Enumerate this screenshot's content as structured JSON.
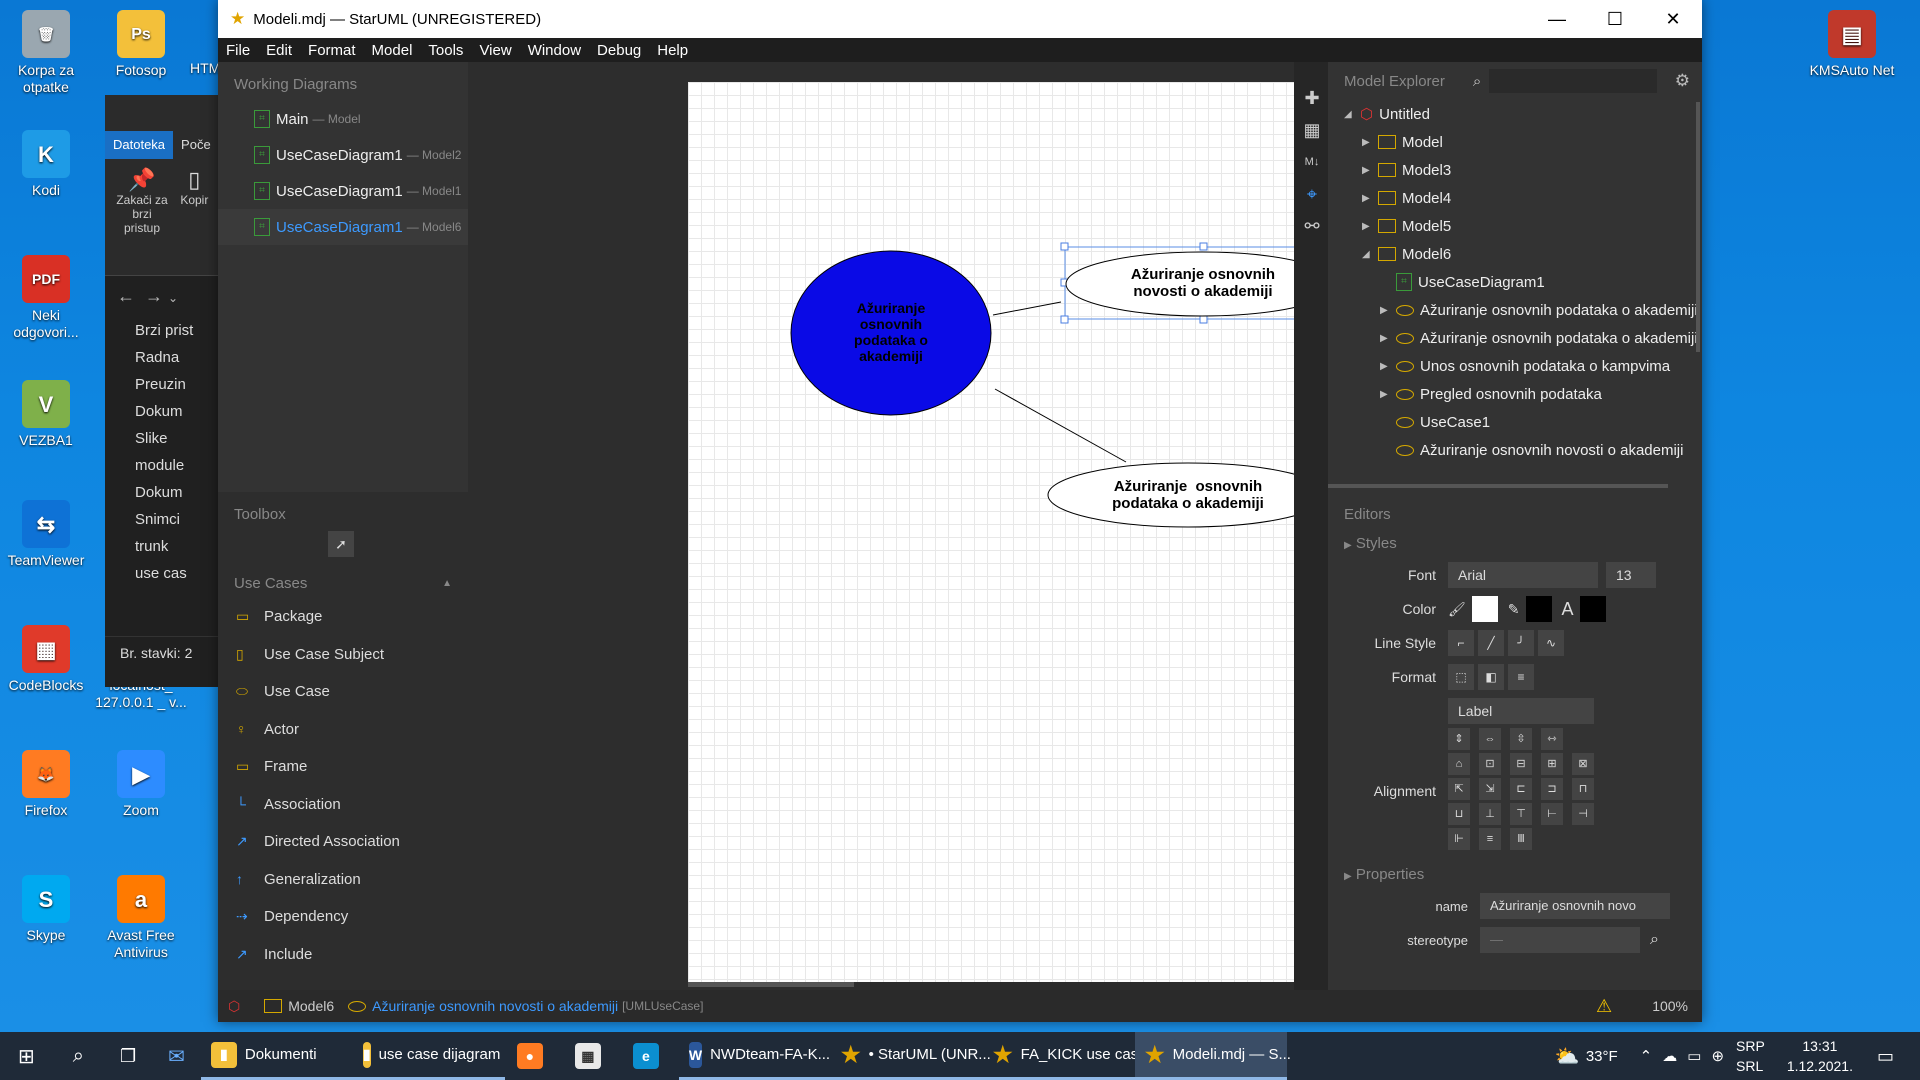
{
  "desktop": {
    "icons_left": [
      {
        "label": "Korpa za otpatke",
        "color": "#9aa7b0",
        "glyph": "🗑"
      },
      {
        "label": "Kodi",
        "color": "#1e9be6",
        "glyph": "K"
      },
      {
        "label": "Neki odgovori...",
        "color": "#d93025",
        "glyph": "PDF"
      },
      {
        "label": "VEZBA1",
        "color": "#7fb04a",
        "glyph": "V"
      },
      {
        "label": "TeamViewer",
        "color": "#0e72d6",
        "glyph": "⇆"
      },
      {
        "label": "CodeBlocks",
        "color": "#e03a2a",
        "glyph": "▦"
      },
      {
        "label": "Firefox",
        "color": "#ff7b22",
        "glyph": "🦊"
      },
      {
        "label": "Skype",
        "color": "#00a9f0",
        "glyph": "S"
      }
    ],
    "icons_second": [
      {
        "label": "Fotosop",
        "color": "#f3c03a",
        "glyph": "Ps"
      },
      {
        "label": "localhost_ 127.0.0.1 _ v...",
        "color": "#e0e0e0",
        "glyph": "▭"
      },
      {
        "label": "Zoom",
        "color": "#2d8cff",
        "glyph": "▶"
      },
      {
        "label": "Avast Free Antivirus",
        "color": "#ff7a00",
        "glyph": "a"
      }
    ],
    "icon_htm": "HTM",
    "icon_right": {
      "label": "KMSAuto Net",
      "color": "#c0392b",
      "glyph": "▤"
    }
  },
  "explorer": {
    "tab_active": "Datoteka",
    "tab_other": "Poče",
    "pin_label": "Zakači za brzi pristup",
    "copy_label": "Kopir",
    "items": [
      "Brzi prist",
      "Radna",
      "Preuzin",
      "Dokum",
      "Slike",
      "module",
      "Dokum",
      "Snimci",
      "trunk",
      "use cas"
    ],
    "status": "Br. stavki: 2"
  },
  "window": {
    "title": "Modeli.mdj — StarUML (UNREGISTERED)",
    "menu": [
      "File",
      "Edit",
      "Format",
      "Model",
      "Tools",
      "View",
      "Window",
      "Debug",
      "Help"
    ]
  },
  "working_diagrams": {
    "title": "Working Diagrams",
    "items": [
      {
        "label": "Main",
        "sub": "— Model"
      },
      {
        "label": "UseCaseDiagram1",
        "sub": "— Model2"
      },
      {
        "label": "UseCaseDiagram1",
        "sub": "— Model1"
      },
      {
        "label": "UseCaseDiagram1",
        "sub": "— Model6"
      }
    ]
  },
  "toolbox": {
    "title": "Toolbox",
    "group": "Use Cases",
    "items": [
      "Package",
      "Use Case Subject",
      "Use Case",
      "Actor",
      "Frame",
      "Association",
      "Directed Association",
      "Generalization",
      "Dependency",
      "Include"
    ]
  },
  "diagram": {
    "uc_blue": "Ažuriranje osnovnih podataka o akademiji",
    "uc_top": "Ažuriranje osnovnih novosti o akademiji",
    "uc_bottom": "Ažuriranje  osnovnih podataka o akademiji",
    "blue_color": "#0a0ae6"
  },
  "model_explorer": {
    "title": "Model Explorer",
    "root": "Untitled",
    "models": [
      "Model",
      "Model3",
      "Model4",
      "Model5",
      "Model6"
    ],
    "model6_children": [
      "UseCaseDiagram1",
      "Ažuriranje osnovnih podataka o akademiji",
      "Ažuriranje osnovnih podataka o akademiji",
      "Unos osnovnih podataka o kampvima",
      "Pregled osnovnih podataka",
      "UseCase1",
      "Ažuriranje osnovnih novosti o akademiji"
    ]
  },
  "editors": {
    "title": "Editors",
    "styles": "Styles",
    "font_label": "Font",
    "font": "Arial",
    "font_size": "13",
    "color_label": "Color",
    "line_style_label": "Line Style",
    "format_label": "Format",
    "format_value": "Label",
    "alignment_label": "Alignment",
    "properties": "Properties",
    "name_label": "name",
    "name_value": "Ažuriranje osnovnih novo",
    "stereotype_label": "stereotype",
    "stereotype_value": "—"
  },
  "statusbar": {
    "model": "Model6",
    "element": "Ažuriranje osnovnih novosti o akademiji",
    "type": "[UMLUseCase]",
    "zoom": "100%"
  },
  "taskbar": {
    "apps": [
      {
        "label": "Dokumenti",
        "color": "#f3c03a",
        "glyph": "▮"
      },
      {
        "label": "use case dijagram",
        "color": "#f3c03a",
        "glyph": "▮"
      },
      {
        "label": "",
        "color": "#ff7b22",
        "glyph": "●"
      },
      {
        "label": "",
        "color": "#e8e8e8",
        "glyph": "▦"
      },
      {
        "label": "",
        "color": "#0b8fd0",
        "glyph": "e"
      },
      {
        "label": "NWDteam-FA-K...",
        "color": "#2b579a",
        "glyph": "W"
      },
      {
        "label": "• StarUML (UNR...",
        "color": "#e0a400",
        "glyph": "★"
      },
      {
        "label": "FA_KICK use cas...",
        "color": "#e0a400",
        "glyph": "★"
      },
      {
        "label": "Modeli.mdj — S...",
        "color": "#e0a400",
        "glyph": "★"
      }
    ],
    "weather": "33°F",
    "lang1": "SRP",
    "lang2": "SRL",
    "time": "13:31",
    "date": "1.12.2021."
  }
}
